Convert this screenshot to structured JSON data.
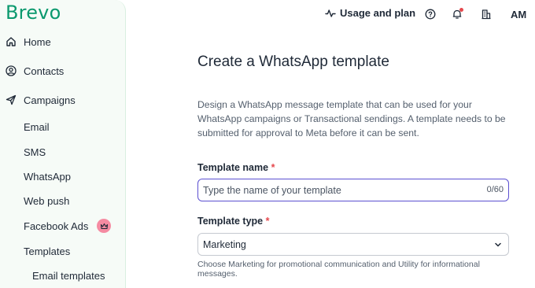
{
  "brand": {
    "logo_text": "Brevo",
    "accent_color": "#0b996e"
  },
  "sidebar": {
    "items": [
      {
        "label": "Home",
        "icon": "home-icon"
      },
      {
        "label": "Contacts",
        "icon": "contacts-icon"
      },
      {
        "label": "Campaigns",
        "icon": "send-icon"
      }
    ],
    "campaign_sub_items": [
      "Email",
      "SMS",
      "WhatsApp",
      "Web push",
      "Facebook Ads",
      "Templates"
    ],
    "template_sub_items": [
      "Email templates"
    ],
    "facebook_ads_badge_icon": "crown-icon"
  },
  "topbar": {
    "usage_label": "Usage and plan",
    "icons": [
      "activity-icon",
      "help-icon",
      "bell-icon",
      "building-icon"
    ],
    "avatar_initials": "AM"
  },
  "main": {
    "title": "Create a WhatsApp template",
    "description": "Design a WhatsApp message template that can be used for your WhatsApp campaigns or Transactional sendings. A template needs to be submitted for approval to Meta before it can be sent.",
    "template_name": {
      "label": "Template name",
      "required_mark": "*",
      "placeholder": "Type the name of your template",
      "value": "",
      "counter": "0/60"
    },
    "template_type": {
      "label": "Template type",
      "required_mark": "*",
      "selected": "Marketing",
      "helper": "Choose Marketing for promotional communication and Utility for informational messages."
    }
  }
}
